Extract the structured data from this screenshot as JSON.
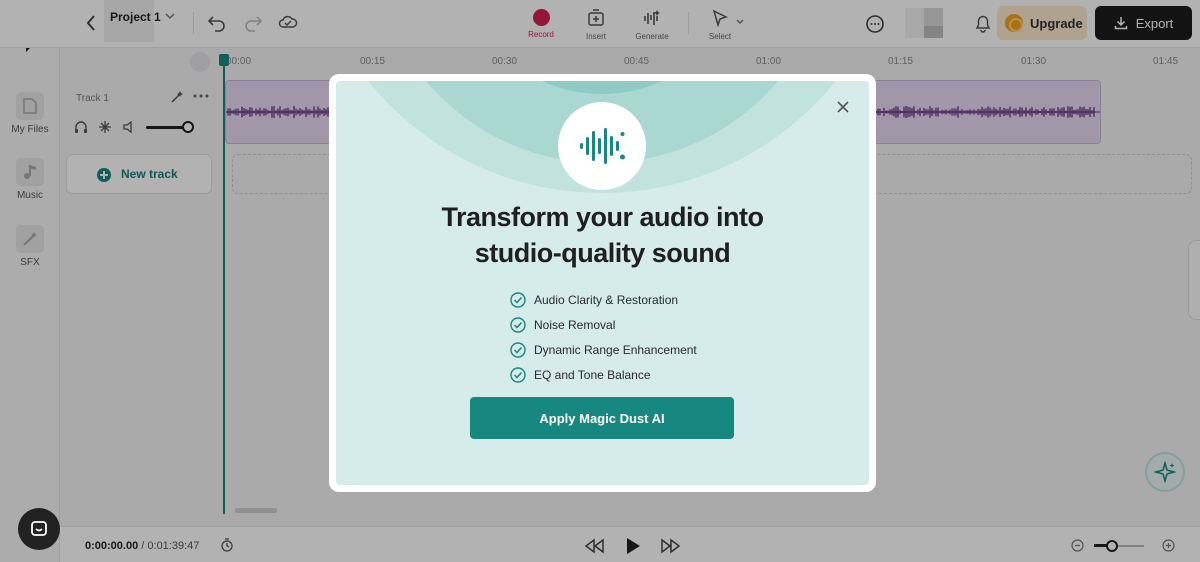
{
  "header": {
    "project_title": "Project 1",
    "tools": [
      {
        "label": "Record"
      },
      {
        "label": "Insert"
      },
      {
        "label": "Generate"
      },
      {
        "label": "Select"
      }
    ],
    "upgrade_label": "Upgrade",
    "export_label": "Export"
  },
  "sidebar": {
    "items": [
      {
        "label": "My Files"
      },
      {
        "label": "Music"
      },
      {
        "label": "SFX"
      }
    ]
  },
  "timeline": {
    "ticks": [
      "00:00",
      "00:15",
      "00:30",
      "00:45",
      "01:00",
      "01:15",
      "01:30",
      "01:45"
    ],
    "track_name": "Track 1",
    "new_track_label": "New track"
  },
  "transport": {
    "current_time": "0:00:00.00",
    "separator": " / ",
    "total_time": "0:01:39:47"
  },
  "modal": {
    "title_line1": "Transform your audio into",
    "title_line2": "studio-quality sound",
    "features": [
      "Audio Clarity & Restoration",
      "Noise Removal",
      "Dynamic Range Enhancement",
      "EQ and Tone Balance"
    ],
    "cta_label": "Apply Magic Dust AI"
  },
  "colors": {
    "accent": "#17887f",
    "record": "#d61f52",
    "modal_bg": "#d5ecea",
    "clip_bg": "#e8d8f2",
    "waveform": "#5a2a78"
  }
}
